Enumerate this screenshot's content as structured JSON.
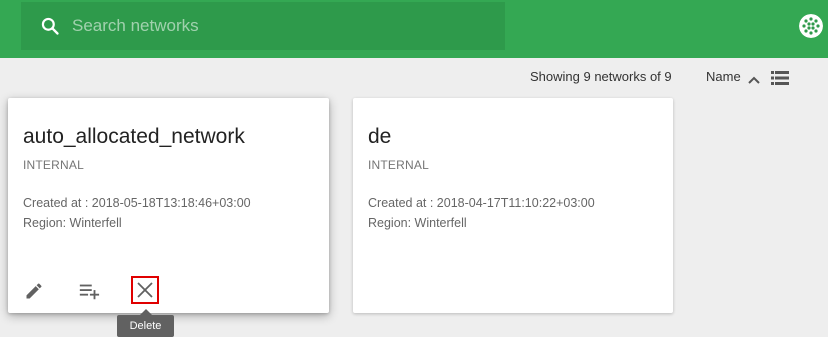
{
  "search": {
    "placeholder": "Search networks",
    "icon": "search-icon"
  },
  "header": {
    "avatar_icon": "user-avatar-icon",
    "accent_color": "#34a853"
  },
  "toolbar": {
    "count_text": "Showing 9 networks of 9",
    "sort_label": "Name",
    "sort_direction": "ascending",
    "view_icon": "list-view-icon"
  },
  "networks": [
    {
      "name": "auto_allocated_network",
      "type": "INTERNAL",
      "created": "Created at : 2018-05-18T13:18:46+03:00",
      "region": "Region: Winterfell"
    },
    {
      "name": "de",
      "type": "INTERNAL",
      "created": "Created at : 2018-04-17T11:10:22+03:00",
      "region": "Region: Winterfell"
    }
  ],
  "card_actions": {
    "edit_icon": "pencil-icon",
    "add_icon": "playlist-add-icon",
    "delete_icon": "close-icon"
  },
  "tooltip": {
    "text": "Delete"
  }
}
